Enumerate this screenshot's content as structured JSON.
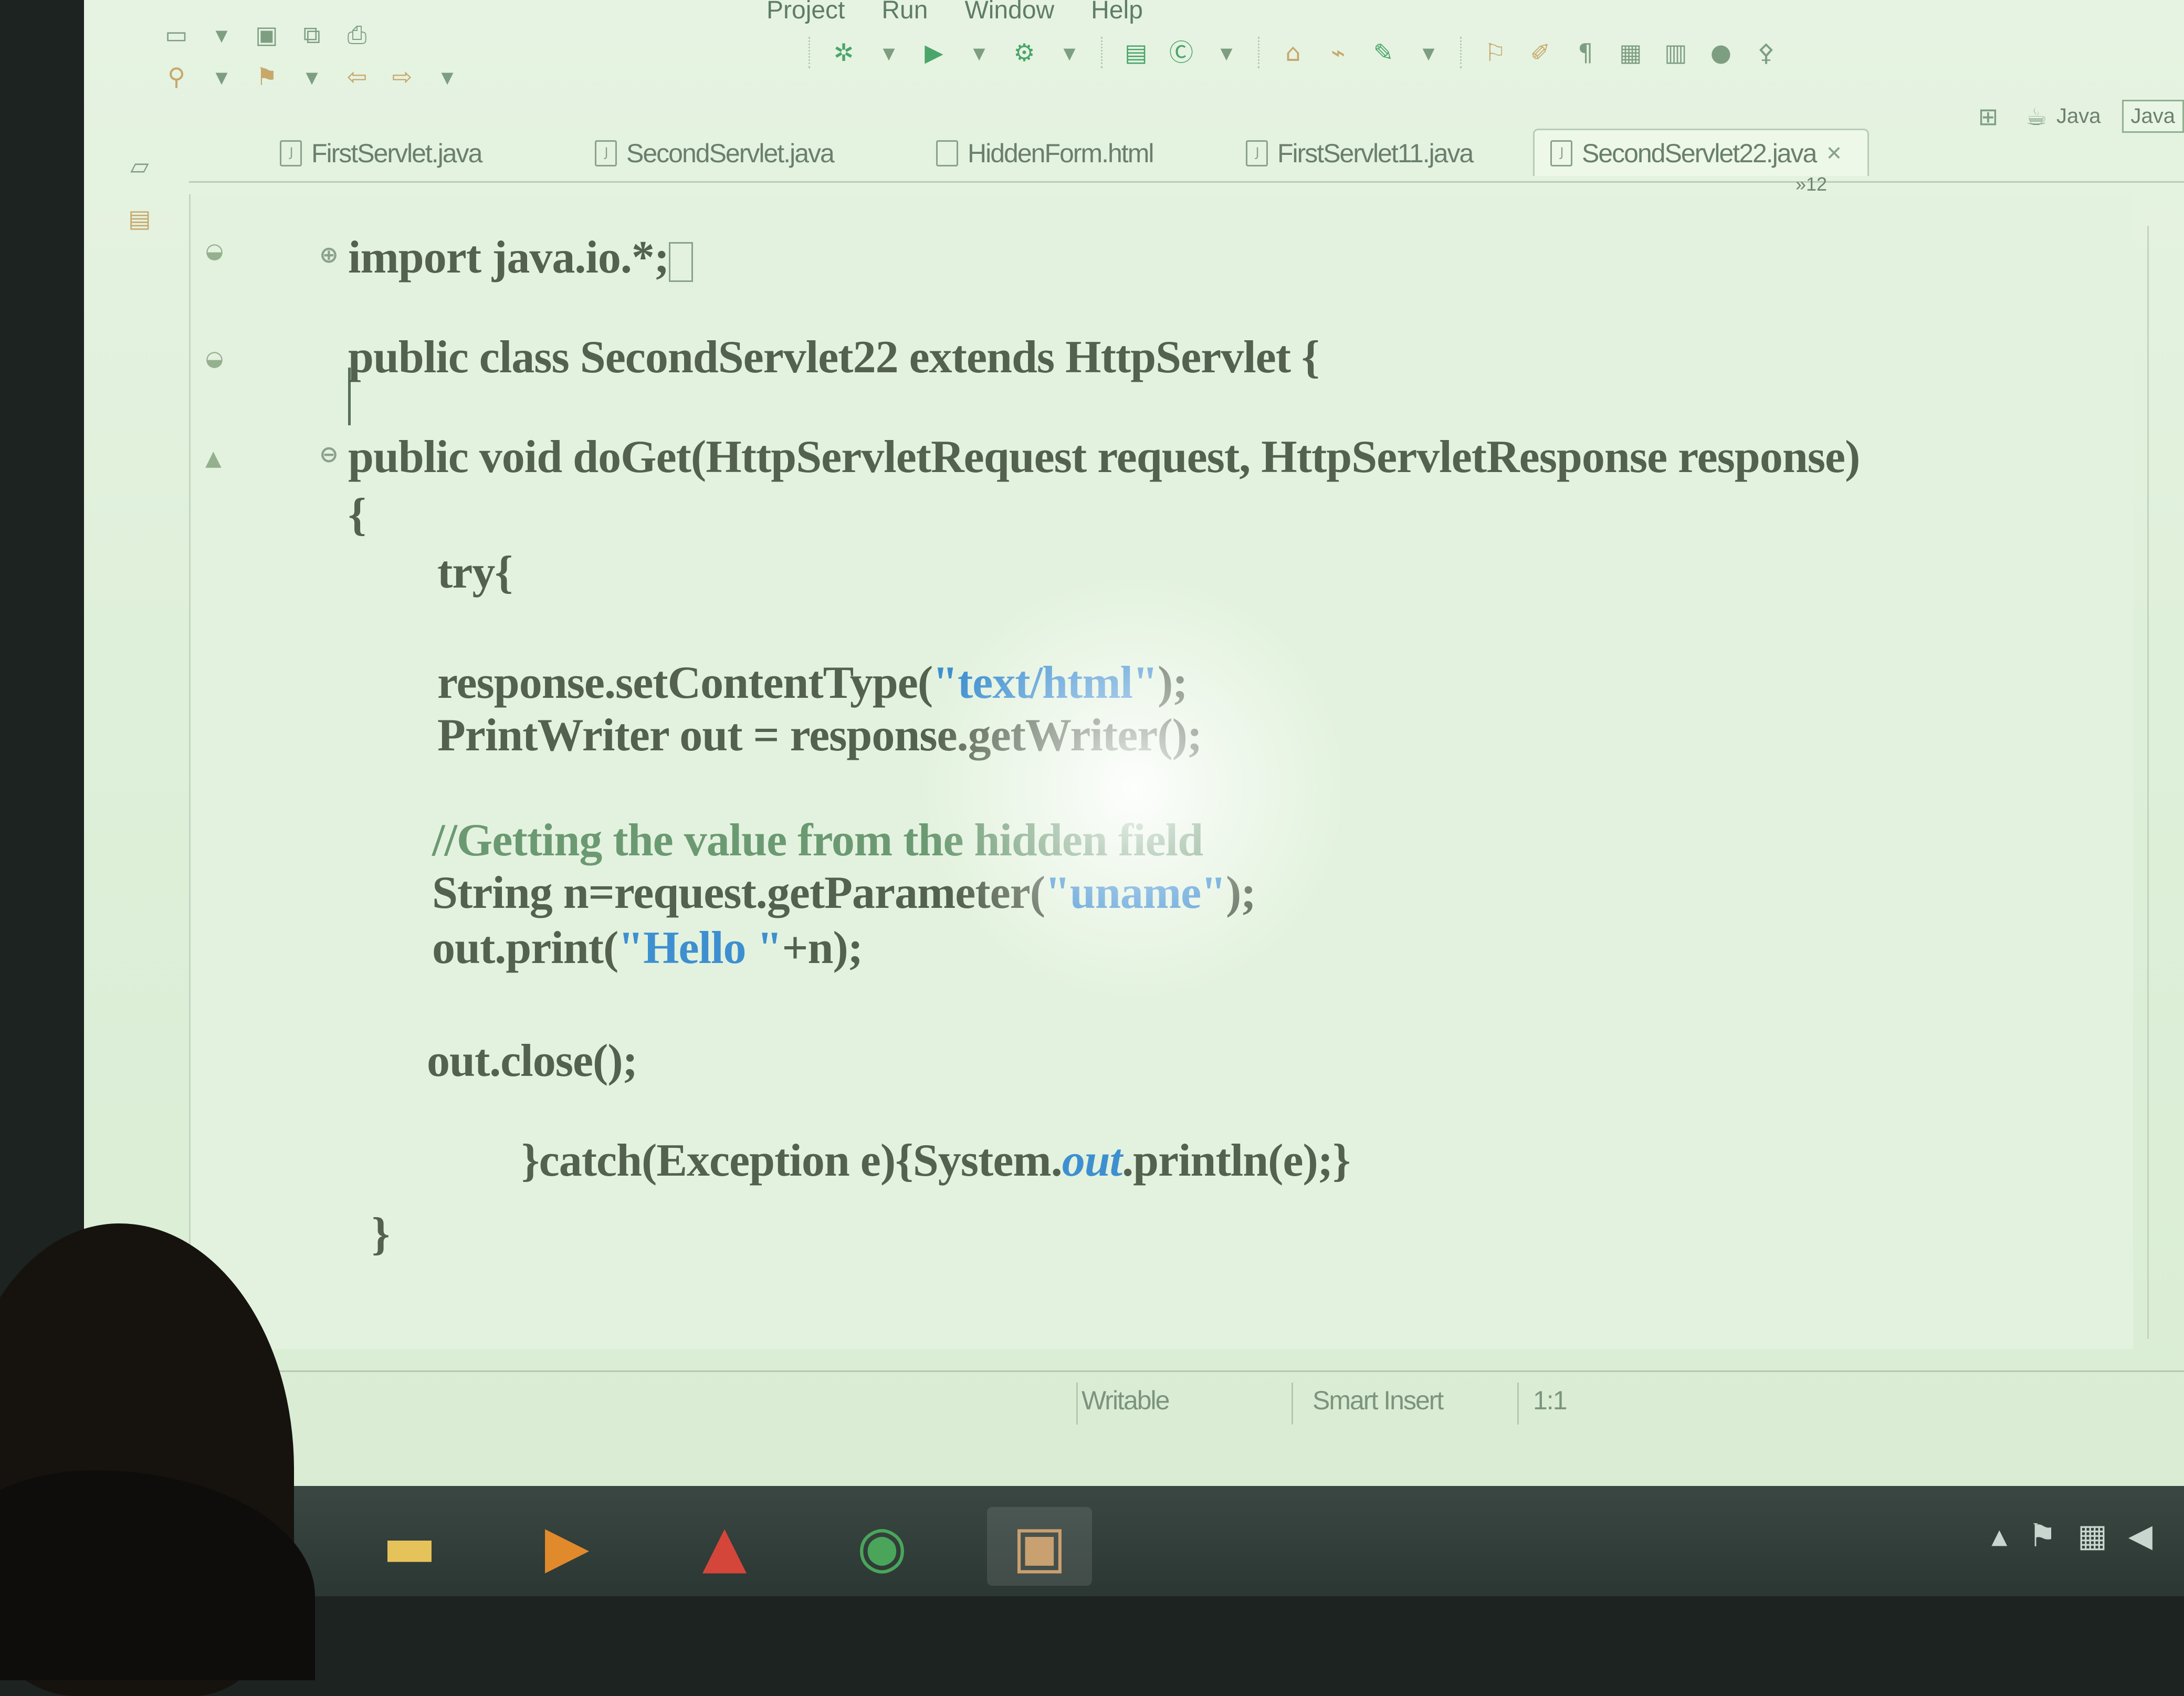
{
  "menubar": {
    "items": [
      "Project",
      "Run",
      "Window",
      "Help"
    ]
  },
  "toolbar": {
    "row1_icons": [
      "new-icon",
      "dropdown-icon",
      "save-icon",
      "save-all-icon",
      "print-icon"
    ],
    "row2_icons": [
      "debug-icon",
      "run-icon",
      "external-tools-icon",
      "new-class-icon",
      "open-type-icon",
      "search-icon",
      "annotation-icon",
      "back-icon",
      "forward-icon"
    ],
    "perspectives": [
      "Java",
      "Java"
    ]
  },
  "tabs": [
    {
      "label": "FirstServlet.java",
      "active": false
    },
    {
      "label": "SecondServlet.java",
      "active": false
    },
    {
      "label": "HiddenForm.html",
      "active": false
    },
    {
      "label": "FirstServlet11.java",
      "active": false
    },
    {
      "label": "SecondServlet22.java",
      "active": true
    }
  ],
  "tab_overflow": "»12",
  "code": {
    "line_import": "import java.io.*;",
    "line_class": "public class SecondServlet22 extends HttpServlet {",
    "line_method": "public void doGet(HttpServletRequest request, HttpServletResponse response)",
    "line_open_brace": "{",
    "line_try": "try{",
    "line_setct_a": "response.setContentType(",
    "line_setct_str": "\"text/html\"",
    "line_setct_b": ");",
    "line_writer": "PrintWriter out = response.getWriter();",
    "line_comment": "//Getting the value from the hidden field",
    "line_getparam_a": "String n=request.getParameter(",
    "line_getparam_str": "\"uname\"",
    "line_getparam_b": ");",
    "line_print_a": "out.print(",
    "line_print_str": "\"Hello \"",
    "line_print_b": "+n);",
    "line_close": "out.close();",
    "line_catch_a": "}catch(Exception e){System.",
    "line_catch_out": "out",
    "line_catch_b": ".println(e);}",
    "line_close_brace": "}"
  },
  "status": {
    "writable": "Writable",
    "insert_mode": "Smart Insert",
    "position": "1:1"
  },
  "taskbar": {
    "apps": [
      "file-explorer-icon",
      "media-player-icon",
      "paint-icon",
      "chrome-icon",
      "app-icon"
    ]
  },
  "colors": {
    "screen_bg": "#e3f2de",
    "keyword_text": "#54614f",
    "string_text": "#3e8fd0",
    "comment_text": "#6b9a72"
  }
}
